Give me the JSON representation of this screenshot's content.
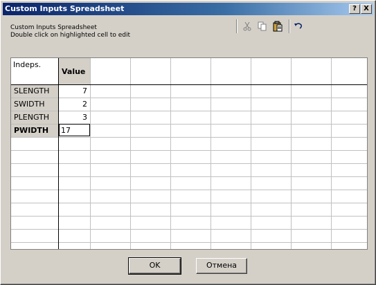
{
  "window": {
    "title": "Custom Inputs Spreadsheet",
    "help_label": "?",
    "close_label": "X"
  },
  "info": {
    "line1": "Custom Inputs Spreadsheet",
    "line2": "Double click on highlighted cell to edit"
  },
  "toolbar": {
    "icons": [
      "cut-icon",
      "copy-icon",
      "paste-icon",
      "undo-icon"
    ]
  },
  "grid": {
    "corner_label": "Indeps.",
    "column_header": "Value",
    "rows": [
      {
        "label": "SLENGTH",
        "value": "7"
      },
      {
        "label": "SWIDTH",
        "value": "2"
      },
      {
        "label": "PLENGTH",
        "value": "3"
      },
      {
        "label": "PWIDTH",
        "value": "17"
      }
    ]
  },
  "buttons": {
    "ok": "OK",
    "cancel": "Отмена"
  },
  "colors": {
    "titlebar_start": "#0a246a",
    "titlebar_end": "#a6caf0",
    "face": "#d4d0c8"
  }
}
